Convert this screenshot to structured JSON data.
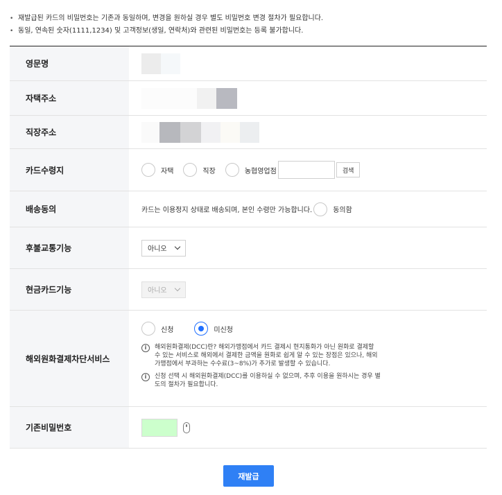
{
  "notes": [
    "재발급된 카드의 비밀번호는 기존과 동일하며, 변경을 원하실 경우 별도 비밀번호 변경 절차가 필요합니다.",
    "동일, 연속된 숫자(1111,1234) 및 고객정보(생일, 연락처)와 관련된 비밀번호는 등록 불가합니다."
  ],
  "form": {
    "english_name": {
      "label": "영문명"
    },
    "home_address": {
      "label": "자택주소"
    },
    "work_address": {
      "label": "직장주소"
    },
    "card_receipt": {
      "label": "카드수령지",
      "options": [
        "자택",
        "직장",
        "농협영업점"
      ],
      "branch_value": "",
      "search_button": "검색"
    },
    "delivery_consent": {
      "label": "배송동의",
      "text": "카드는 이용정지 상태로 배송되며, 본인 수령만 가능합니다.",
      "agree_label": "동의함"
    },
    "transit": {
      "label": "후불교통기능",
      "selected": "아니오"
    },
    "cash_card": {
      "label": "현금카드기능",
      "selected": "아니오"
    },
    "dcc": {
      "label": "해외원화결제차단서비스",
      "options": [
        {
          "text": "신청",
          "checked": false
        },
        {
          "text": "미신청",
          "checked": true
        }
      ],
      "info1": "해외원화결제(DCC)란? 해외가맹점에서 카드 결제시 현지통화가 아닌 원화로 결제할 수 있는 서비스로 해외에서 결제한 금액을 원화로 쉽게 알 수 있는 장점은 있으나, 해외가맹점에서 부과하는 수수료(3~8%)가 추가로 발생할 수 있습니다.",
      "info2": "신청 선택 시 해외원화결제(DCC)를 이용하실 수 없으며, 추후 이용을 원하시는 경우 별도의 절차가 필요합니다."
    },
    "password": {
      "label": "기존비밀번호",
      "field_color": "#ccffcc"
    }
  },
  "submit_label": "재발급",
  "colors": {
    "accent": "#2f80f5",
    "radio_selected": "#1f6fff",
    "label_bg": "#f5f6f8"
  }
}
